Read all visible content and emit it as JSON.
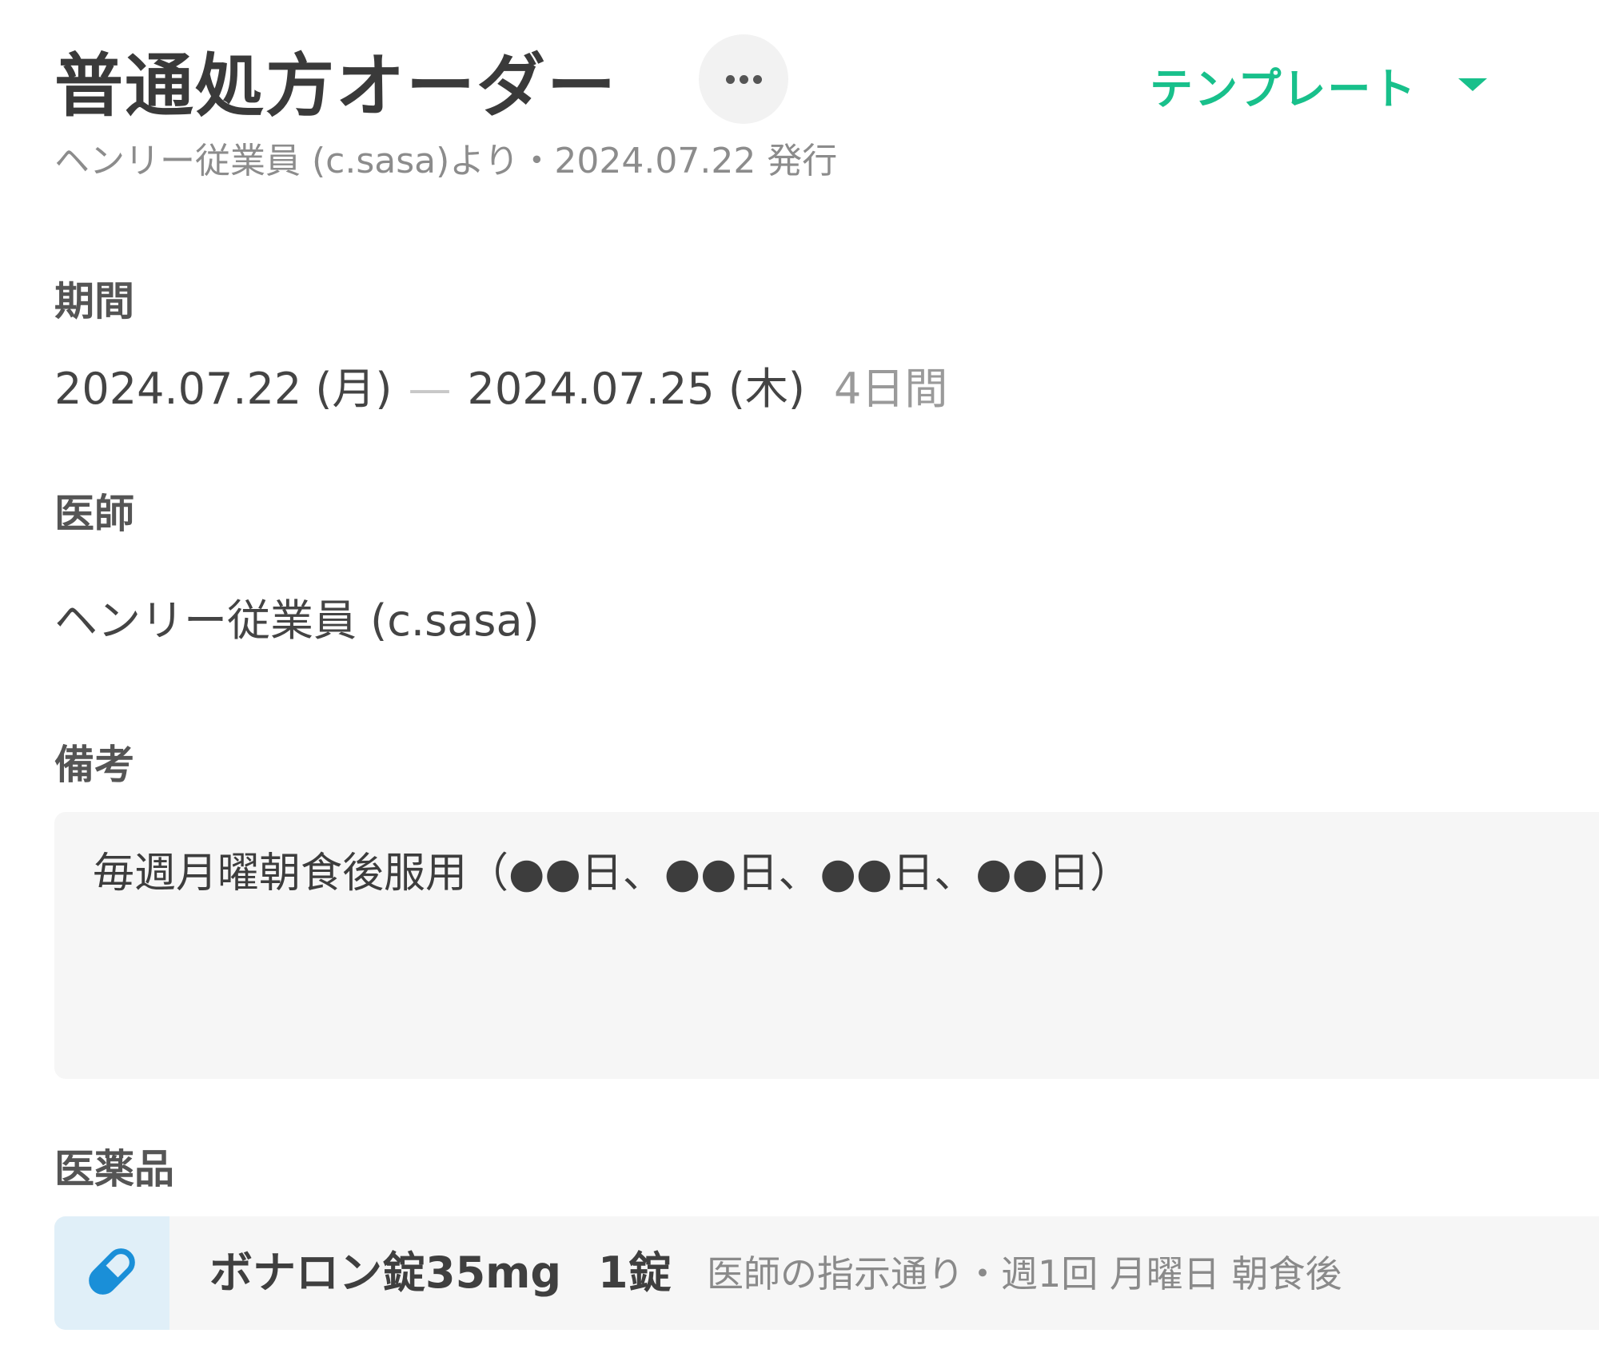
{
  "header": {
    "title": "普通処方オーダー",
    "more_icon": "more-horizontal-icon",
    "template_label": "テンプレート",
    "template_icon": "caret-down-icon",
    "subtitle": "ヘンリー従業員 (c.sasa)より・2024.07.22 発行"
  },
  "period": {
    "label": "期間",
    "start": "2024.07.22 (月)",
    "separator": "—",
    "end": "2024.07.25 (木)",
    "duration": "4日間"
  },
  "doctor": {
    "label": "医師",
    "value": "ヘンリー従業員 (c.sasa)"
  },
  "notes": {
    "label": "備考",
    "text": "毎週月曜朝食後服用（●●日、●●日、●●日、●●日）"
  },
  "medicines": {
    "label": "医薬品",
    "items": [
      {
        "icon": "pill-icon",
        "name": "ボナロン錠35mg",
        "quantity": "1錠",
        "instructions": "医師の指示通り・週1回 月曜日 朝食後"
      }
    ]
  },
  "colors": {
    "accent": "#18c08b",
    "pill_icon": "#1a8fd8",
    "icon_bg": "#e0eff8",
    "panel_bg": "#f6f6f6"
  }
}
